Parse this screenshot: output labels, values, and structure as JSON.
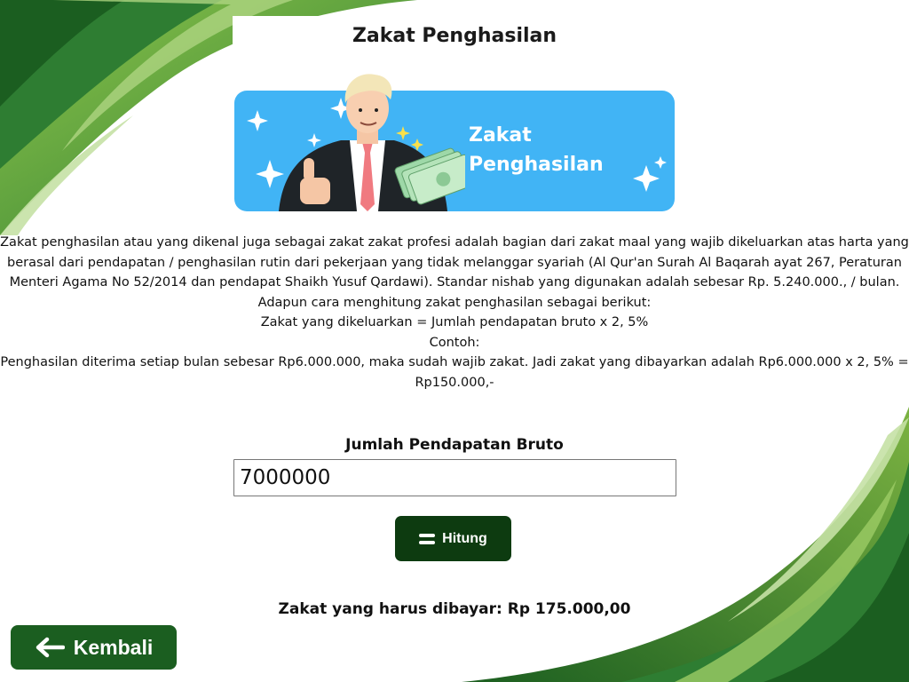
{
  "page": {
    "title": "Zakat Penghasilan"
  },
  "banner": {
    "line1": "Zakat",
    "line2": "Penghasilan",
    "color": "#41b4f5"
  },
  "description": {
    "lines": [
      "Zakat penghasilan atau yang dikenal juga sebagai zakat zakat profesi adalah bagian dari zakat maal yang wajib dikeluarkan atas harta yang",
      "berasal dari pendapatan / penghasilan rutin dari pekerjaan yang tidak melanggar syariah (Al Qur'an Surah Al Baqarah ayat 267, Peraturan",
      "Menteri Agama No 52/2014 dan pendapat Shaikh Yusuf Qardawi). Standar nishab yang digunakan adalah sebesar Rp. 5.240.000., / bulan.",
      "Adapun cara menghitung zakat penghasilan sebagai berikut:",
      "Zakat yang dikeluarkan = Jumlah pendapatan bruto x 2, 5%",
      "Contoh:",
      "Penghasilan diterima setiap bulan sebesar Rp6.000.000, maka sudah wajib zakat. Jadi zakat yang dibayarkan adalah Rp6.000.000 x 2, 5% =",
      "Rp150.000,-"
    ]
  },
  "form": {
    "label": "Jumlah Pendapatan Bruto",
    "value": "7000000",
    "button_label": "Hitung",
    "button_icon": "equals-icon"
  },
  "result": {
    "text": "Zakat yang harus dibayar: Rp 175.000,00"
  },
  "nav": {
    "back_label": "Kembali",
    "back_icon": "arrow-left-icon"
  },
  "colors": {
    "dark_green": "#0d3b10",
    "back_green": "#1b5e20",
    "leaf_green": "#4a9a2c"
  }
}
